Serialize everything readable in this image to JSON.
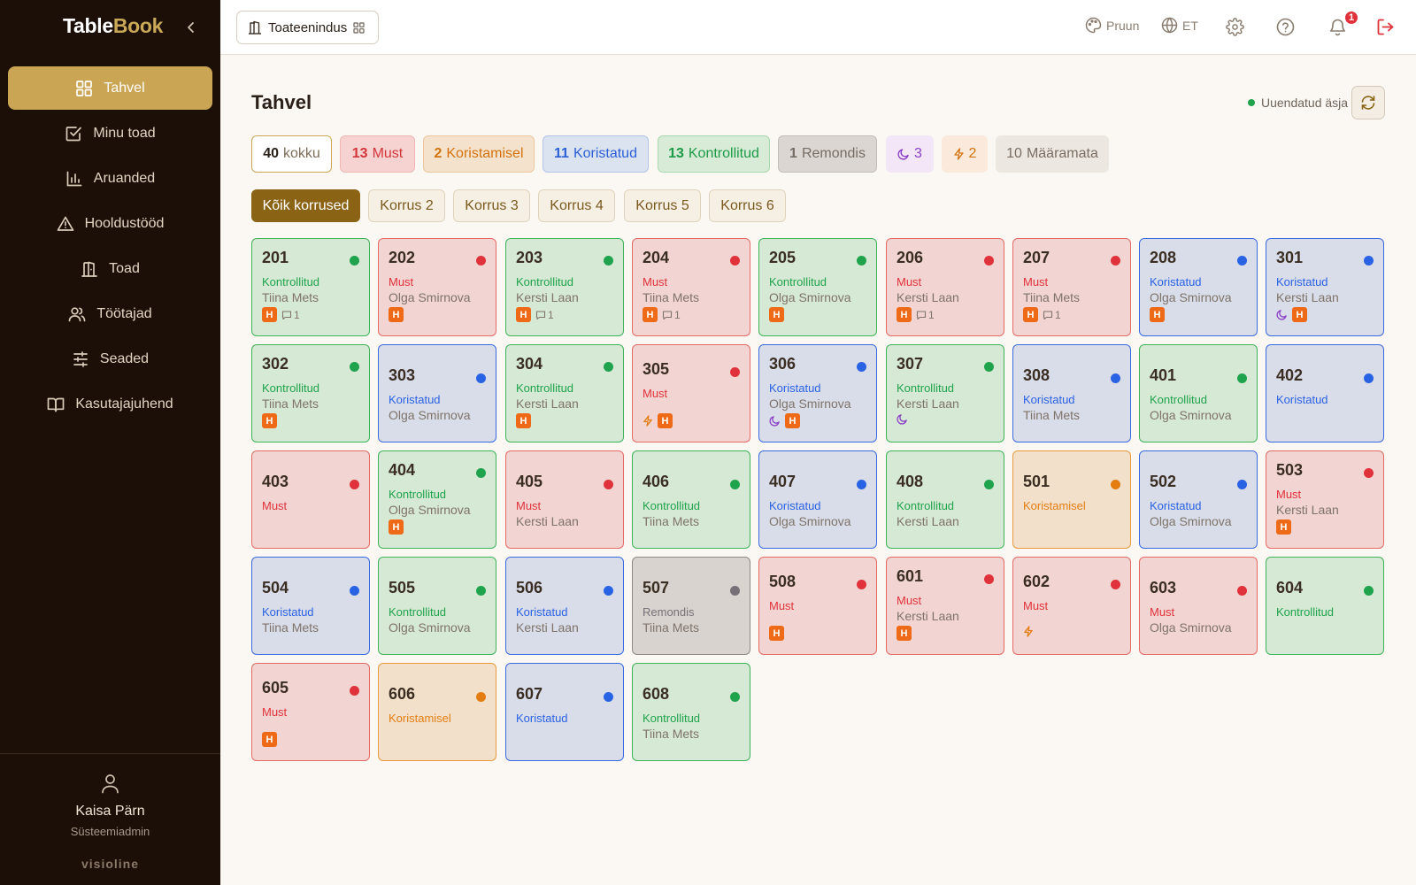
{
  "app": {
    "brand_part1": "Table",
    "brand_part2": "Book"
  },
  "sidebar": {
    "items": [
      {
        "label": "Tahvel",
        "icon": "grid-icon",
        "active": true
      },
      {
        "label": "Minu toad",
        "icon": "checkbox-icon"
      },
      {
        "label": "Aruanded",
        "icon": "bar-chart-icon"
      },
      {
        "label": "Hooldustööd",
        "icon": "warning-icon"
      },
      {
        "label": "Toad",
        "icon": "door-icon"
      },
      {
        "label": "Töötajad",
        "icon": "users-icon"
      },
      {
        "label": "Seaded",
        "icon": "sliders-icon"
      },
      {
        "label": "Kasutajajuhend",
        "icon": "book-icon"
      }
    ],
    "user_name": "Kaisa Pärn",
    "user_role": "Süsteemiadmin",
    "vendor": "visioline"
  },
  "header": {
    "department": "Toateenindus",
    "theme_label": "Pruun",
    "language_label": "ET",
    "notification_count": "1"
  },
  "page": {
    "title": "Tahvel",
    "updated_label": "Uuendatud äsja"
  },
  "stats": [
    {
      "count": "40",
      "label": "kokku",
      "key": "total"
    },
    {
      "count": "13",
      "label": "Must",
      "key": "dirty"
    },
    {
      "count": "2",
      "label": "Koristamisel",
      "key": "cleaning"
    },
    {
      "count": "11",
      "label": "Koristatud",
      "key": "clean"
    },
    {
      "count": "13",
      "label": "Kontrollitud",
      "key": "inspected"
    },
    {
      "count": "1",
      "label": "Remondis",
      "key": "repair"
    },
    {
      "count": "3",
      "label": "",
      "key": "night"
    },
    {
      "count": "2",
      "label": "",
      "key": "priority"
    },
    {
      "count": "10",
      "label": "Määramata",
      "key": "unassigned"
    }
  ],
  "floors": [
    "Kõik korrused",
    "Korrus 2",
    "Korrus 3",
    "Korrus 4",
    "Korrus 5",
    "Korrus 6"
  ],
  "status_labels": {
    "dirty": "Must",
    "insp": "Kontrollitud",
    "clean": "Koristatud",
    "cleaning": "Koristamisel",
    "repair": "Remondis"
  },
  "status_colors": {
    "dirty": "#e0323a",
    "insp": "#1fa34d",
    "clean": "#2a62e4",
    "cleaning": "#e37d12",
    "repair": "#777079"
  },
  "rooms": [
    {
      "num": "201",
      "status": "insp",
      "staff": "Tiina Mets",
      "h": true,
      "comments": "1"
    },
    {
      "num": "202",
      "status": "dirty",
      "staff": "Olga Smirnova",
      "h": true
    },
    {
      "num": "203",
      "status": "insp",
      "staff": "Kersti Laan",
      "h": true,
      "comments": "1"
    },
    {
      "num": "204",
      "status": "dirty",
      "staff": "Tiina Mets",
      "h": true,
      "comments": "1"
    },
    {
      "num": "205",
      "status": "insp",
      "staff": "Olga Smirnova",
      "h": true
    },
    {
      "num": "206",
      "status": "dirty",
      "staff": "Kersti Laan",
      "h": true,
      "comments": "1"
    },
    {
      "num": "207",
      "status": "dirty",
      "staff": "Tiina Mets",
      "h": true,
      "comments": "1"
    },
    {
      "num": "208",
      "status": "clean",
      "staff": "Olga Smirnova",
      "h": true
    },
    {
      "num": "301",
      "status": "clean",
      "staff": "Kersti Laan",
      "h": true,
      "night": true
    },
    {
      "num": "302",
      "status": "insp",
      "staff": "Tiina Mets",
      "h": true
    },
    {
      "num": "303",
      "status": "clean",
      "staff": "Olga Smirnova"
    },
    {
      "num": "304",
      "status": "insp",
      "staff": "Kersti Laan",
      "h": true
    },
    {
      "num": "305",
      "status": "dirty",
      "h": true,
      "priority": true
    },
    {
      "num": "306",
      "status": "clean",
      "staff": "Olga Smirnova",
      "h": true,
      "night": true
    },
    {
      "num": "307",
      "status": "insp",
      "staff": "Kersti Laan",
      "night": true
    },
    {
      "num": "308",
      "status": "clean",
      "staff": "Tiina Mets"
    },
    {
      "num": "401",
      "status": "insp",
      "staff": "Olga Smirnova"
    },
    {
      "num": "402",
      "status": "clean"
    },
    {
      "num": "403",
      "status": "dirty"
    },
    {
      "num": "404",
      "status": "insp",
      "staff": "Olga Smirnova",
      "h": true
    },
    {
      "num": "405",
      "status": "dirty",
      "staff": "Kersti Laan"
    },
    {
      "num": "406",
      "status": "insp",
      "staff": "Tiina Mets"
    },
    {
      "num": "407",
      "status": "clean",
      "staff": "Olga Smirnova"
    },
    {
      "num": "408",
      "status": "insp",
      "staff": "Kersti Laan"
    },
    {
      "num": "501",
      "status": "cleaning"
    },
    {
      "num": "502",
      "status": "clean",
      "staff": "Olga Smirnova"
    },
    {
      "num": "503",
      "status": "dirty",
      "staff": "Kersti Laan",
      "h": true
    },
    {
      "num": "504",
      "status": "clean",
      "staff": "Tiina Mets"
    },
    {
      "num": "505",
      "status": "insp",
      "staff": "Olga Smirnova"
    },
    {
      "num": "506",
      "status": "clean",
      "staff": "Kersti Laan"
    },
    {
      "num": "507",
      "status": "repair",
      "staff": "Tiina Mets"
    },
    {
      "num": "508",
      "status": "dirty",
      "h": true
    },
    {
      "num": "601",
      "status": "dirty",
      "staff": "Kersti Laan",
      "h": true
    },
    {
      "num": "602",
      "status": "dirty",
      "priority": true
    },
    {
      "num": "603",
      "status": "dirty",
      "staff": "Olga Smirnova"
    },
    {
      "num": "604",
      "status": "insp"
    },
    {
      "num": "605",
      "status": "dirty",
      "h": true
    },
    {
      "num": "606",
      "status": "cleaning"
    },
    {
      "num": "607",
      "status": "clean"
    },
    {
      "num": "608",
      "status": "insp",
      "staff": "Tiina Mets"
    }
  ],
  "badge_letter": "H"
}
